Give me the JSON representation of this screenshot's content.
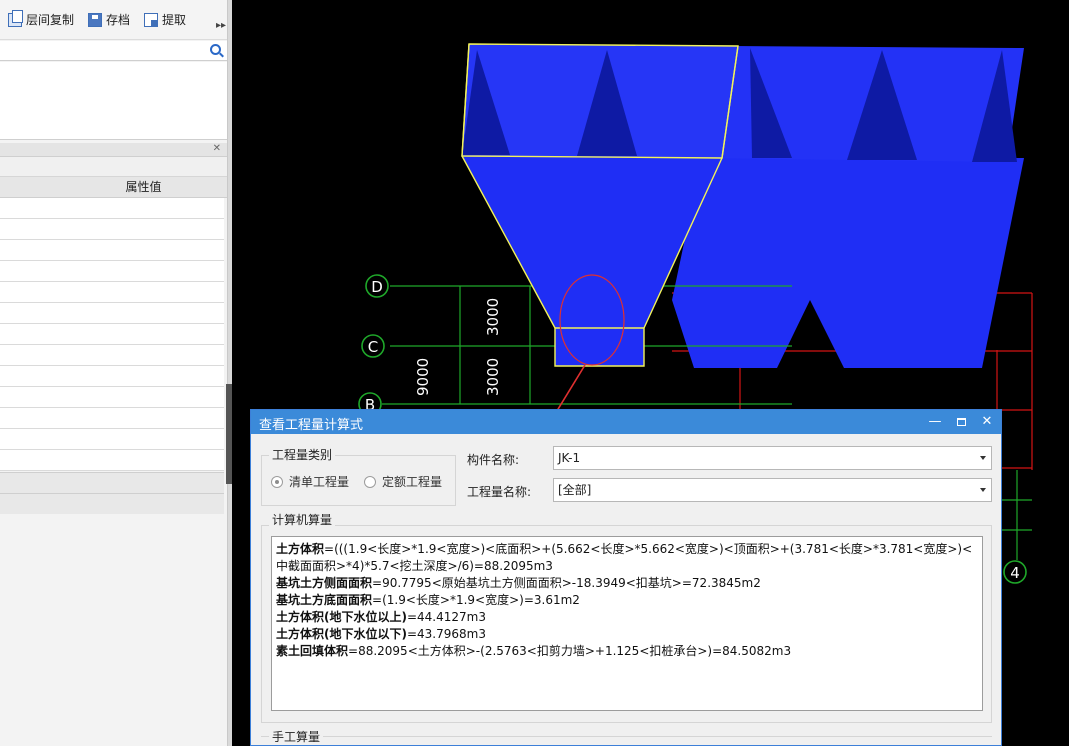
{
  "toolbar": {
    "copy_label": "层间复制",
    "save_label": "存档",
    "extract_label": "提取"
  },
  "properties": {
    "column_value": "属性值"
  },
  "viewport": {
    "axis_labels": [
      "D",
      "C",
      "B",
      "4"
    ],
    "dimensions": [
      "3000",
      "3000",
      "9000"
    ]
  },
  "dialog": {
    "title": "查看工程量计算式",
    "type_group": "工程量类别",
    "radio_bill": "清单工程量",
    "radio_quota": "定额工程量",
    "component_label": "构件名称:",
    "component_value": "JK-1",
    "quantity_label": "工程量名称:",
    "quantity_value": "[全部]",
    "calc_group": "计算机算量",
    "manual_group": "手工算量",
    "lines": [
      {
        "name": "土方体积",
        "expr": "=(((1.9<长度>*1.9<宽度>)<底面积>+(5.662<长度>*5.662<宽度>)<顶面积>+(3.781<长度>*3.781<宽度>)<中截面面积>*4)*5.7<挖土深度>/6)=88.2095m3"
      },
      {
        "name": "基坑土方侧面面积",
        "expr": "=90.7795<原始基坑土方侧面面积>-18.3949<扣基坑>=72.3845m2"
      },
      {
        "name": "基坑土方底面面积",
        "expr": "=(1.9<长度>*1.9<宽度>)=3.61m2"
      },
      {
        "name": "土方体积(地下水位以上)",
        "expr": "=44.4127m3"
      },
      {
        "name": "土方体积(地下水位以下)",
        "expr": "=43.7968m3"
      },
      {
        "name": "素土回填体积",
        "expr": "=88.2095<土方体积>-(2.5763<扣剪力墙>+1.125<扣桩承台>)=84.5082m3"
      }
    ]
  },
  "colors": {
    "title_bar": "#3b8ad9",
    "solid_blue": "#1f2ef5",
    "grid_green": "#1fa82a",
    "grid_red": "#d41414",
    "highlight_yellow": "#f3f35a",
    "annotation_red": "#e03030"
  }
}
